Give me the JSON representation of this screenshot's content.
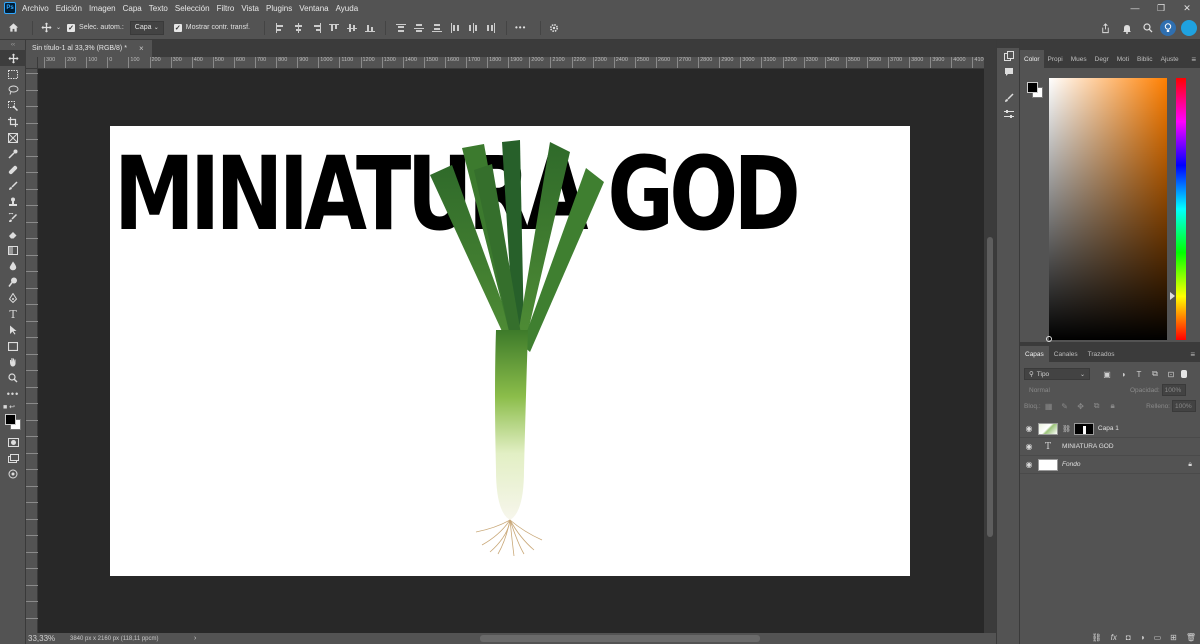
{
  "app": {
    "logo": "Ps"
  },
  "menu": [
    "Archivo",
    "Edición",
    "Imagen",
    "Capa",
    "Texto",
    "Selección",
    "Filtro",
    "Vista",
    "Plugins",
    "Ventana",
    "Ayuda"
  ],
  "window_controls": {
    "minimize": "—",
    "restore": "❐",
    "close": "✕"
  },
  "options": {
    "auto_select_label": "Selec. autom.:",
    "auto_select_value": "Capa",
    "transform_label": "Mostrar contr. transf.",
    "more": "•••"
  },
  "document": {
    "tab_title": "Sin título-1 al 33,3% (RGB/8) *",
    "close": "×",
    "canvas_text": "MINIATURA GOD",
    "zoom": "33,33%",
    "size_info": "3840 px x 2160 px (118,11 ppcm)"
  },
  "ruler_labels": [
    "300",
    "200",
    "100",
    "0",
    "100",
    "200",
    "300",
    "400",
    "500",
    "600",
    "700",
    "800",
    "900",
    "1000",
    "1100",
    "1200",
    "1300",
    "1400",
    "1500",
    "1600",
    "1700",
    "1800",
    "1900",
    "2000",
    "2100",
    "2200",
    "2300",
    "2400",
    "2500",
    "2600",
    "2700",
    "2800",
    "2900",
    "3000",
    "3100",
    "3200",
    "3300",
    "3400",
    "3500",
    "3600",
    "3700",
    "3800",
    "3900",
    "4000",
    "4100"
  ],
  "color_panel": {
    "tabs": [
      "Color",
      "Propi",
      "Mues",
      "Degr",
      "Moti",
      "Biblic",
      "Ajuste"
    ],
    "foreground": "#000000",
    "background": "#ffffff"
  },
  "layers_panel": {
    "tabs": [
      "Capas",
      "Canales",
      "Trazados"
    ],
    "filter": "Tipo",
    "blend_mode": "Normal",
    "opacity_label": "Opacidad:",
    "opacity_value": "100%",
    "lock_label": "Bloq.:",
    "fill_label": "Relleno:",
    "fill_value": "100%",
    "layers": [
      {
        "name": "Capa 1",
        "kind": "image"
      },
      {
        "name": "MINIATURA GOD",
        "kind": "text",
        "glyph": "T"
      },
      {
        "name": "Fondo",
        "kind": "background"
      }
    ]
  }
}
